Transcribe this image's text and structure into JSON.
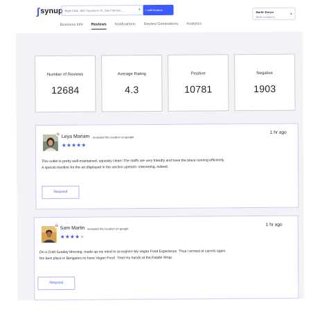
{
  "header": {
    "logo_text": "synup",
    "location_placeholder": "Right Click, 1657 Sycamore St., San Francisc...",
    "add_location_label": "+ Add location",
    "user_name": "Martin Dreyer",
    "user_role": "Multi-Locations"
  },
  "tabs": [
    {
      "label": "Business Info",
      "active": false
    },
    {
      "label": "Reviews",
      "active": true
    },
    {
      "label": "Notifications",
      "active": false
    },
    {
      "label": "Review Generations",
      "active": false
    },
    {
      "label": "Analytics",
      "active": false
    }
  ],
  "stats": [
    {
      "label": "Number of Reviews",
      "value": "12684"
    },
    {
      "label": "Average Rating",
      "value": "4.3"
    },
    {
      "label": "Positive",
      "value": "10781"
    },
    {
      "label": "Negative",
      "value": "1903"
    }
  ],
  "reviews": [
    {
      "name": "Leya Mariam",
      "meta": "reviewed this location on google",
      "rating": 5,
      "time": "1 hr ago",
      "lines": [
        "This outlet is pretty well-maintained- squeaky clean! The staffs are very friendly and have the place running efficiently.",
        "A special mention for the art displayed in the section upstairs- interesting, indeed."
      ],
      "respond_label": "Respond"
    },
    {
      "name": "Sam Martin",
      "meta": "reviewed this location on google",
      "rating": 4,
      "time": "1 hr ago",
      "lines": [
        "On a Cold Sunday Morning, made up my mind to re-explore My vegan Food Experience. Thus i arrived at carrots again,",
        "the best place in Bengaluru to have Vegan Food. Tried my hands at the Falafel Wrap."
      ],
      "respond_label": "Respond"
    }
  ],
  "colors": {
    "accent": "#3b5bfd",
    "star_on": "#3f55e6",
    "star_off": "#c5c8da",
    "card_border": "#c9cdf2",
    "page_bg": "#f2f3f7"
  }
}
